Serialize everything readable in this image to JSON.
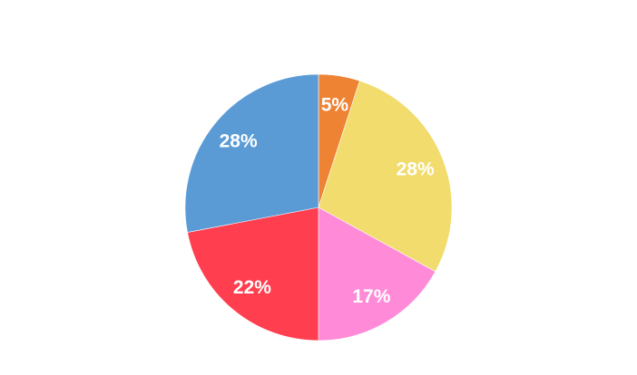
{
  "chart_data": {
    "type": "pie",
    "title": "",
    "start_angle": "12 o'clock",
    "direction": "clockwise",
    "slices": [
      {
        "label": "5%",
        "value": 5,
        "color": "#ee8333"
      },
      {
        "label": "28%",
        "value": 28,
        "color": "#f1dc6d"
      },
      {
        "label": "17%",
        "value": 17,
        "color": "#ff8bd8"
      },
      {
        "label": "22%",
        "value": 22,
        "color": "#ff3f4f"
      },
      {
        "label": "28%",
        "value": 28,
        "color": "#5a9bd6"
      }
    ]
  }
}
